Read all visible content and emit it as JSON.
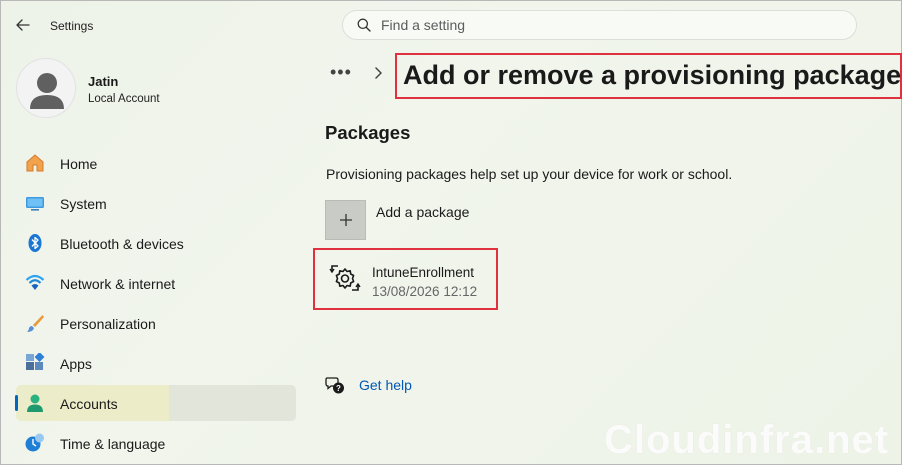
{
  "app": {
    "title": "Settings"
  },
  "search": {
    "placeholder": "Find a setting"
  },
  "profile": {
    "name": "Jatin",
    "account_type": "Local Account"
  },
  "sidebar": {
    "items": [
      {
        "label": "Home",
        "icon": "home-icon",
        "selected": false
      },
      {
        "label": "System",
        "icon": "system-icon",
        "selected": false
      },
      {
        "label": "Bluetooth & devices",
        "icon": "bluetooth-icon",
        "selected": false
      },
      {
        "label": "Network & internet",
        "icon": "network-icon",
        "selected": false
      },
      {
        "label": "Personalization",
        "icon": "personalization-icon",
        "selected": false
      },
      {
        "label": "Apps",
        "icon": "apps-icon",
        "selected": false
      },
      {
        "label": "Accounts",
        "icon": "accounts-icon",
        "selected": true
      },
      {
        "label": "Time & language",
        "icon": "time-language-icon",
        "selected": false
      }
    ]
  },
  "breadcrumb": {
    "more": "•••",
    "separator": "chevron-right-icon"
  },
  "page": {
    "title": "Add or remove a provisioning package",
    "section_title": "Packages",
    "description": "Provisioning packages help set up your device for work or school.",
    "add_label": "Add a package",
    "packages": [
      {
        "name": "IntuneEnrollment",
        "date": "13/08/2026 12:12",
        "icon": "provisioning-package-icon"
      }
    ],
    "help_label": "Get help"
  },
  "watermark": "Cloudinfra.net",
  "colors": {
    "accent": "#0067c0",
    "highlight_border": "#e0323e",
    "link": "#0058b3"
  }
}
